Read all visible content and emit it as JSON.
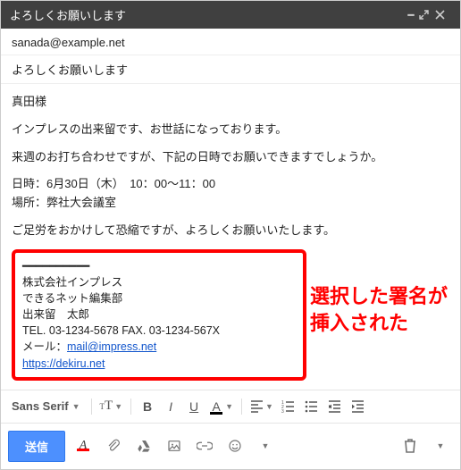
{
  "window": {
    "title": "よろしくお願いします"
  },
  "header": {
    "to": "sanada@example.net",
    "subject": "よろしくお願いします"
  },
  "body": {
    "greeting": "真田様",
    "intro": "インプレスの出来留です、お世話になっております。",
    "line1": "来週のお打ち合わせですが、下記の日時でお願いできますでしょうか。",
    "datetime": "日時：6月30日（木）　10：00～11：00",
    "place": "場所：弊社大会議室",
    "closing": "ご足労をおかけして恐縮ですが、よろしくお願いいたします。"
  },
  "signature": {
    "rule": "━━━━━━━━━━",
    "company": "株式会社インプレス",
    "dept": "できるネット編集部",
    "name": "出来留　太郎",
    "tel_label": "TEL. ",
    "tel": "03-1234-5678",
    "fax_label": "   FAX. ",
    "fax": "03-1234-567X",
    "mail_label": "メール：",
    "mail": "mail@impress.net",
    "url": "https://dekiru.net"
  },
  "annotation": {
    "line1": "選択した署名が",
    "line2": "挿入された"
  },
  "toolbar": {
    "font": "Sans Serif",
    "send": "送信"
  }
}
